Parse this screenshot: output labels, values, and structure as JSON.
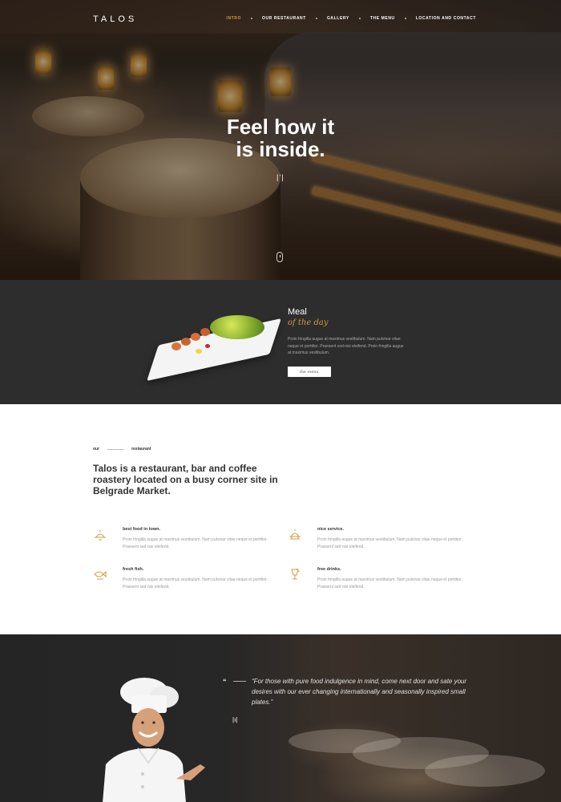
{
  "brand": {
    "logo": "TALOS"
  },
  "nav": {
    "items": [
      {
        "label": "Intro",
        "active": true
      },
      {
        "label": "Our restaurant",
        "active": false
      },
      {
        "label": "Gallery",
        "active": false
      },
      {
        "label": "The menu",
        "active": false
      },
      {
        "label": "Location and contact",
        "active": false
      }
    ]
  },
  "hero": {
    "title_line1": "Feel how it",
    "title_line2": "is inside.",
    "mark": "|’|"
  },
  "meal": {
    "title": "Meal",
    "subtitle": "of the day",
    "text": "Proin fringilla augue at maximus vestibulum. Nam pulvinar vitae neque et porttitor. Praesent sed nisi eleifend. Proin fringilla augue at maximus vestibulum.",
    "button": "the menu"
  },
  "about": {
    "eyebrow_left": "our",
    "eyebrow_right": "restaurant",
    "heading": "Talos is a restaurant, bar and coffee roastery located on a busy corner site in Belgrade Market.",
    "features": [
      {
        "title": "best food in town.",
        "text": "Proin fringilla augue at maximus vestibulum. Nam pulvinar vitae neque et porttitor. Praesent sed nisi eleifend.",
        "icon": "dish-icon"
      },
      {
        "title": "nice service.",
        "text": "Proin fringilla augue at maximus vestibulum. Nam pulvinar vitae neque et porttitor. Praesent sed nisi eleifend.",
        "icon": "cloche-icon"
      },
      {
        "title": "fresh fish.",
        "text": "Proin fringilla augue at maximus vestibulum. Nam pulvinar vitae neque et porttitor. Praesent sed nisi eleifend.",
        "icon": "fish-icon"
      },
      {
        "title": "free drinks.",
        "text": "Proin fringilla augue at maximus vestibulum. Nam pulvinar vitae neque et porttitor. Praesent sed nisi eleifend.",
        "icon": "drink-icon"
      }
    ]
  },
  "quote": {
    "mark": "“",
    "text": "“For those with pure food indulgence in mind, come next door and sate your desires with our ever changing internationally and seasonally inspired small plates.”",
    "signature": "|ı|"
  },
  "colors": {
    "accent": "#d69b3c",
    "dark": "#2d2d2d"
  }
}
